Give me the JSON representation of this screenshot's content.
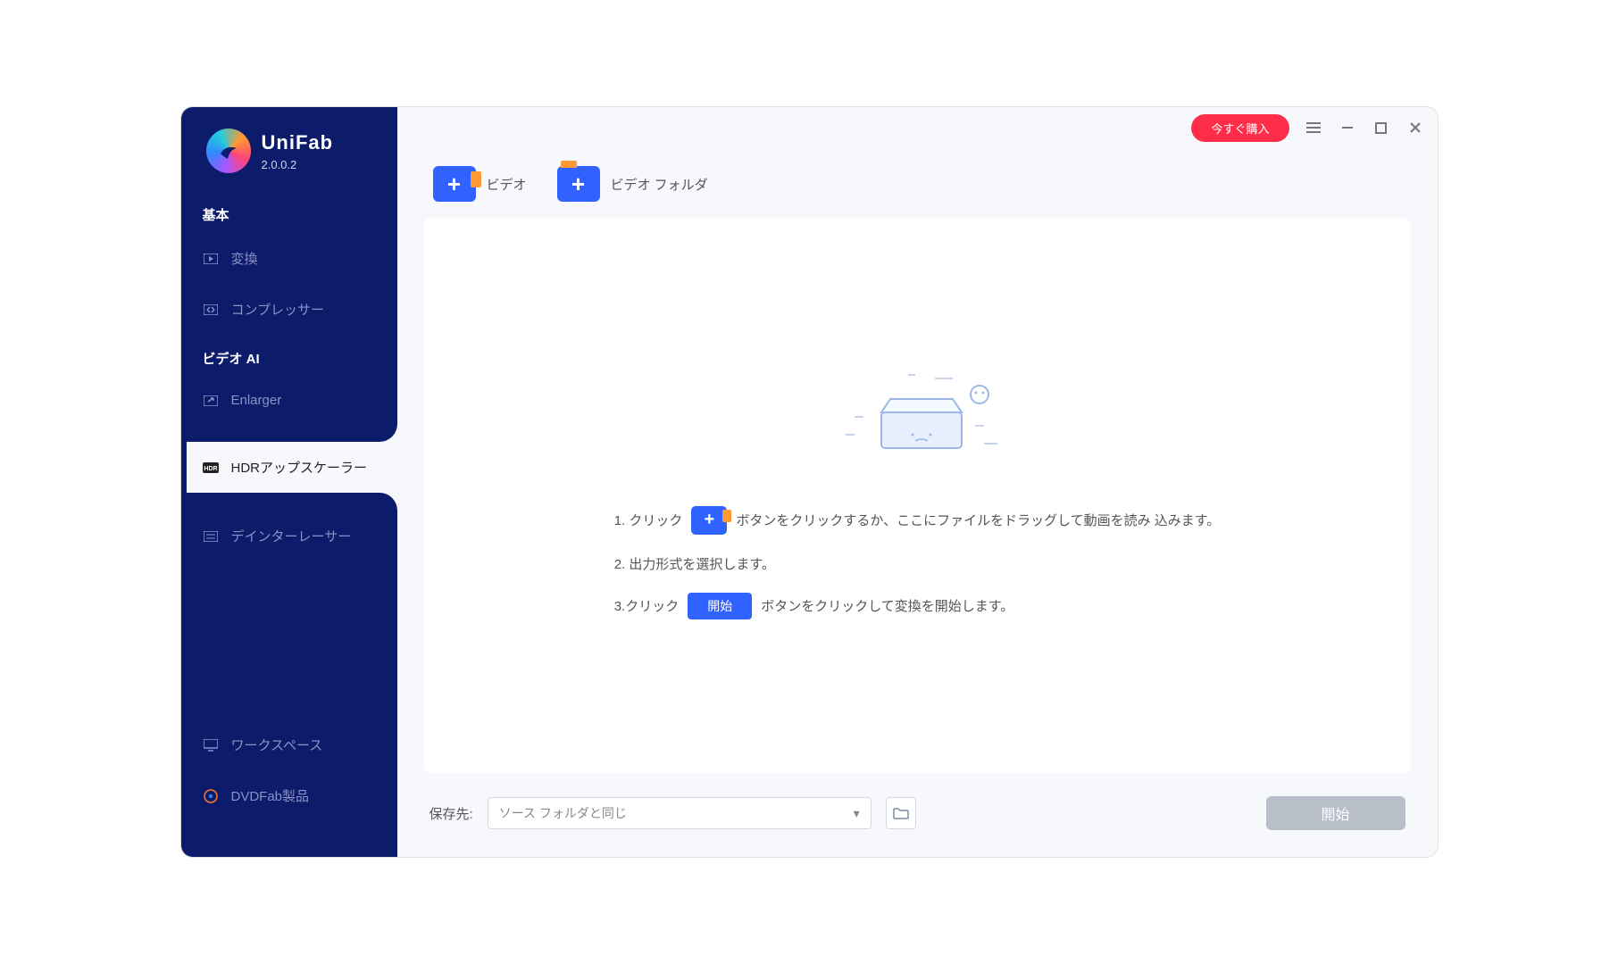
{
  "app": {
    "name": "UniFab",
    "version": "2.0.0.2"
  },
  "titlebar": {
    "buy_label": "今すぐ購入"
  },
  "sidebar": {
    "section_basic": "基本",
    "section_video_ai": "ビデオ AI",
    "items": {
      "convert": "変換",
      "compressor": "コンプレッサー",
      "enlarger": "Enlarger",
      "hdr_upscaler": "HDRアップスケーラー",
      "deinterlacer": "デインターレーサー",
      "workspace": "ワークスペース",
      "dvdfab": "DVDFab製品"
    }
  },
  "toolbar": {
    "video_label": "ビデオ",
    "video_folder_label": "ビデオ フォルダ"
  },
  "instructions": {
    "step1_prefix": "1. クリック",
    "step1_suffix": "ボタンをクリックするか、ここにファイルをドラッグして動画を読み 込みます。",
    "step2": "2. 出力形式を選択します。",
    "step3_prefix": "3.クリック",
    "step3_btn": "開始",
    "step3_suffix": "ボタンをクリックして変換を開始します。"
  },
  "footer": {
    "save_to_label": "保存先:",
    "select_value": "ソース フォルダと同じ",
    "start_label": "開始"
  }
}
